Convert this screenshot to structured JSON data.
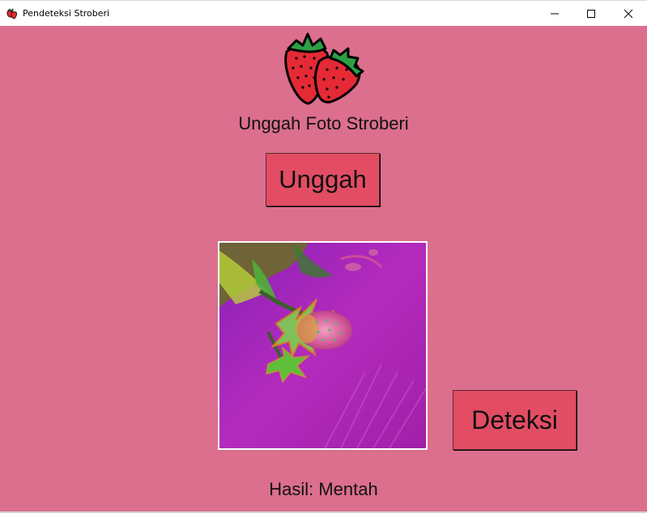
{
  "window": {
    "title": "Pendeteksi Stroberi",
    "app_icon": "strawberry-icon",
    "controls": [
      "minimize-icon",
      "maximize-icon",
      "close-icon"
    ]
  },
  "main": {
    "logo_icon": "strawberries-icon",
    "heading": "Unggah Foto Stroberi",
    "upload_label": "Unggah",
    "detect_label": "Deteksi",
    "result_text": "Hasil: Mentah"
  },
  "colors": {
    "background": "#db6f8d",
    "button": "#e24d63",
    "strawberry": "#e52a35",
    "leaf": "#2e9e46"
  }
}
